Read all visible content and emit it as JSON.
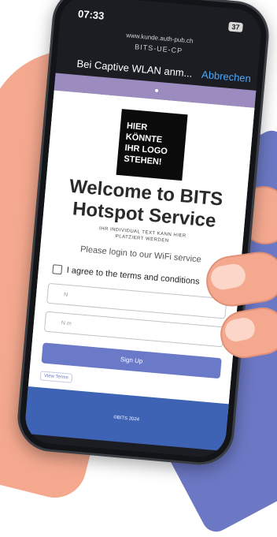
{
  "status": {
    "time": "07:33",
    "battery": "37"
  },
  "browser": {
    "url": "www.kunde.auth-pub.ch",
    "ssid": "BITS-UE-CP"
  },
  "nav": {
    "title": "Bei Captive WLAN anm...",
    "cancel": "Abbrechen"
  },
  "page": {
    "logo_text": "HIER KÖNNTE IHR LOGO STEHEN!",
    "welcome": "Welcome to BITS Hotspot Service",
    "small_text": "IHR INDIVIDUAL TEXT KANN HIER PLATZIERT WERDEN",
    "login_hint": "Please login to our WiFi service",
    "agree_label": "I agree to the terms and conditions",
    "name_placeholder": "N",
    "number_placeholder": "N m",
    "signup_label": "Sign Up",
    "terms_link": "View Terms",
    "footer": "©BITS 2024"
  },
  "colors": {
    "accent": "#6a7ac8",
    "nav_link": "#4aa8ff",
    "band": "#9b8bbf"
  }
}
